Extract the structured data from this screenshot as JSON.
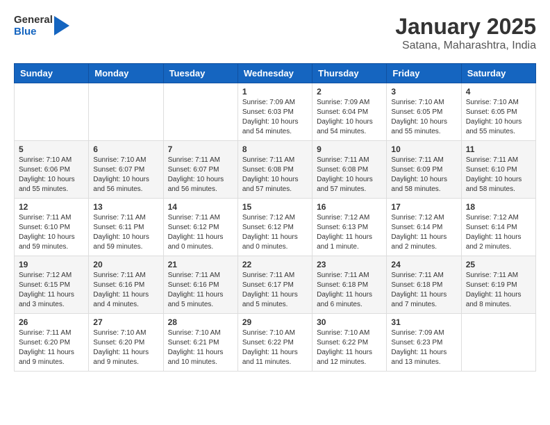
{
  "header": {
    "logo_line1": "General",
    "logo_line2": "Blue",
    "month": "January 2025",
    "location": "Satana, Maharashtra, India"
  },
  "weekdays": [
    "Sunday",
    "Monday",
    "Tuesday",
    "Wednesday",
    "Thursday",
    "Friday",
    "Saturday"
  ],
  "weeks": [
    [
      {
        "day": "",
        "info": ""
      },
      {
        "day": "",
        "info": ""
      },
      {
        "day": "",
        "info": ""
      },
      {
        "day": "1",
        "info": "Sunrise: 7:09 AM\nSunset: 6:03 PM\nDaylight: 10 hours\nand 54 minutes."
      },
      {
        "day": "2",
        "info": "Sunrise: 7:09 AM\nSunset: 6:04 PM\nDaylight: 10 hours\nand 54 minutes."
      },
      {
        "day": "3",
        "info": "Sunrise: 7:10 AM\nSunset: 6:05 PM\nDaylight: 10 hours\nand 55 minutes."
      },
      {
        "day": "4",
        "info": "Sunrise: 7:10 AM\nSunset: 6:05 PM\nDaylight: 10 hours\nand 55 minutes."
      }
    ],
    [
      {
        "day": "5",
        "info": "Sunrise: 7:10 AM\nSunset: 6:06 PM\nDaylight: 10 hours\nand 55 minutes."
      },
      {
        "day": "6",
        "info": "Sunrise: 7:10 AM\nSunset: 6:07 PM\nDaylight: 10 hours\nand 56 minutes."
      },
      {
        "day": "7",
        "info": "Sunrise: 7:11 AM\nSunset: 6:07 PM\nDaylight: 10 hours\nand 56 minutes."
      },
      {
        "day": "8",
        "info": "Sunrise: 7:11 AM\nSunset: 6:08 PM\nDaylight: 10 hours\nand 57 minutes."
      },
      {
        "day": "9",
        "info": "Sunrise: 7:11 AM\nSunset: 6:08 PM\nDaylight: 10 hours\nand 57 minutes."
      },
      {
        "day": "10",
        "info": "Sunrise: 7:11 AM\nSunset: 6:09 PM\nDaylight: 10 hours\nand 58 minutes."
      },
      {
        "day": "11",
        "info": "Sunrise: 7:11 AM\nSunset: 6:10 PM\nDaylight: 10 hours\nand 58 minutes."
      }
    ],
    [
      {
        "day": "12",
        "info": "Sunrise: 7:11 AM\nSunset: 6:10 PM\nDaylight: 10 hours\nand 59 minutes."
      },
      {
        "day": "13",
        "info": "Sunrise: 7:11 AM\nSunset: 6:11 PM\nDaylight: 10 hours\nand 59 minutes."
      },
      {
        "day": "14",
        "info": "Sunrise: 7:11 AM\nSunset: 6:12 PM\nDaylight: 11 hours\nand 0 minutes."
      },
      {
        "day": "15",
        "info": "Sunrise: 7:12 AM\nSunset: 6:12 PM\nDaylight: 11 hours\nand 0 minutes."
      },
      {
        "day": "16",
        "info": "Sunrise: 7:12 AM\nSunset: 6:13 PM\nDaylight: 11 hours\nand 1 minute."
      },
      {
        "day": "17",
        "info": "Sunrise: 7:12 AM\nSunset: 6:14 PM\nDaylight: 11 hours\nand 2 minutes."
      },
      {
        "day": "18",
        "info": "Sunrise: 7:12 AM\nSunset: 6:14 PM\nDaylight: 11 hours\nand 2 minutes."
      }
    ],
    [
      {
        "day": "19",
        "info": "Sunrise: 7:12 AM\nSunset: 6:15 PM\nDaylight: 11 hours\nand 3 minutes."
      },
      {
        "day": "20",
        "info": "Sunrise: 7:11 AM\nSunset: 6:16 PM\nDaylight: 11 hours\nand 4 minutes."
      },
      {
        "day": "21",
        "info": "Sunrise: 7:11 AM\nSunset: 6:16 PM\nDaylight: 11 hours\nand 5 minutes."
      },
      {
        "day": "22",
        "info": "Sunrise: 7:11 AM\nSunset: 6:17 PM\nDaylight: 11 hours\nand 5 minutes."
      },
      {
        "day": "23",
        "info": "Sunrise: 7:11 AM\nSunset: 6:18 PM\nDaylight: 11 hours\nand 6 minutes."
      },
      {
        "day": "24",
        "info": "Sunrise: 7:11 AM\nSunset: 6:18 PM\nDaylight: 11 hours\nand 7 minutes."
      },
      {
        "day": "25",
        "info": "Sunrise: 7:11 AM\nSunset: 6:19 PM\nDaylight: 11 hours\nand 8 minutes."
      }
    ],
    [
      {
        "day": "26",
        "info": "Sunrise: 7:11 AM\nSunset: 6:20 PM\nDaylight: 11 hours\nand 9 minutes."
      },
      {
        "day": "27",
        "info": "Sunrise: 7:10 AM\nSunset: 6:20 PM\nDaylight: 11 hours\nand 9 minutes."
      },
      {
        "day": "28",
        "info": "Sunrise: 7:10 AM\nSunset: 6:21 PM\nDaylight: 11 hours\nand 10 minutes."
      },
      {
        "day": "29",
        "info": "Sunrise: 7:10 AM\nSunset: 6:22 PM\nDaylight: 11 hours\nand 11 minutes."
      },
      {
        "day": "30",
        "info": "Sunrise: 7:10 AM\nSunset: 6:22 PM\nDaylight: 11 hours\nand 12 minutes."
      },
      {
        "day": "31",
        "info": "Sunrise: 7:09 AM\nSunset: 6:23 PM\nDaylight: 11 hours\nand 13 minutes."
      },
      {
        "day": "",
        "info": ""
      }
    ]
  ]
}
